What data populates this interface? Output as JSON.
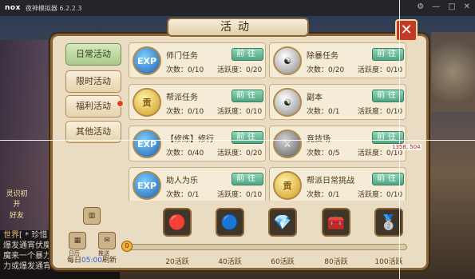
{
  "window": {
    "logo": "nox",
    "title": "夜神模拟器 6.2.2.3",
    "controls": [
      "⚙",
      "—",
      "□",
      "✕"
    ]
  },
  "scene": {
    "chat_lines": [
      {
        "tag": "世界",
        "text": "[ * 珍惜"
      },
      {
        "tag": "",
        "text": "爆发通宵伏魔"
      },
      {
        "tag": "",
        "text": "魔来一个暴力"
      },
      {
        "tag": "",
        "text": "力或爆发通宵伏"
      }
    ],
    "side_labels": [
      "灵识初开",
      "好友"
    ]
  },
  "panel": {
    "title": "活动",
    "close_icon": "close-icon"
  },
  "tabs": [
    {
      "label": "日常活动",
      "active": true,
      "badge": false
    },
    {
      "label": "限时活动",
      "active": false,
      "badge": false
    },
    {
      "label": "福利活动",
      "active": false,
      "badge": true
    },
    {
      "label": "其他活动",
      "active": false,
      "badge": false
    }
  ],
  "quests": [
    {
      "name": "师门任务",
      "icon": "exp-icon",
      "icon_text": "EXP",
      "count": "次数：0/10",
      "activity": "活跃度：0/20",
      "button": "前往"
    },
    {
      "name": "除暴任务",
      "icon": "yinyang-icon",
      "icon_text": "☯",
      "count": "次数：0/20",
      "activity": "活跃度：0/10",
      "button": "前往"
    },
    {
      "name": "帮派任务",
      "icon": "coin-icon",
      "icon_text": "贡",
      "count": "次数：0/10",
      "activity": "活跃度：0/10",
      "button": "前往"
    },
    {
      "name": "副本",
      "icon": "yinyang-icon",
      "icon_text": "☯",
      "count": "次数：0/1",
      "activity": "活跃度：0/10",
      "button": "前往"
    },
    {
      "name": "【修炼】修行",
      "icon": "exp-icon",
      "icon_text": "EXP",
      "count": "次数：0/40",
      "activity": "活跃度：0/20",
      "button": "前往"
    },
    {
      "name": "竞技场",
      "icon": "swords-icon",
      "icon_text": "⚔",
      "count": "次数：0/5",
      "activity": "活跃度：0/10",
      "button": "前往"
    },
    {
      "name": "助人为乐",
      "icon": "exp-icon",
      "icon_text": "EXP",
      "count": "次数：0/1",
      "activity": "活跃度：0/10",
      "button": "前往"
    },
    {
      "name": "帮派日常挑战",
      "icon": "coin-icon",
      "icon_text": "贡",
      "count": "次数：0/1",
      "activity": "活跃度：0/10",
      "button": "前往"
    }
  ],
  "rewards": {
    "start_value": "0",
    "progress": 0,
    "items": [
      {
        "label": "20活跃",
        "icon": "red-orb-icon",
        "glyph": "🔴"
      },
      {
        "label": "40活跃",
        "icon": "blue-orb-icon",
        "glyph": "🔵"
      },
      {
        "label": "60活跃",
        "icon": "pink-gems-icon",
        "glyph": "💎"
      },
      {
        "label": "80活跃",
        "icon": "treasure-chest-icon",
        "glyph": "🧰"
      },
      {
        "label": "100活跃",
        "icon": "silver-ingot-icon",
        "glyph": "🥈"
      }
    ],
    "left_buttons": {
      "chart_label": "",
      "calendar_label": "日历",
      "push_label": "推送"
    },
    "refresh_prefix": "每日",
    "refresh_time": "05:00",
    "refresh_suffix": "刷新"
  },
  "overlay": {
    "coordinate": "1358, 504"
  }
}
